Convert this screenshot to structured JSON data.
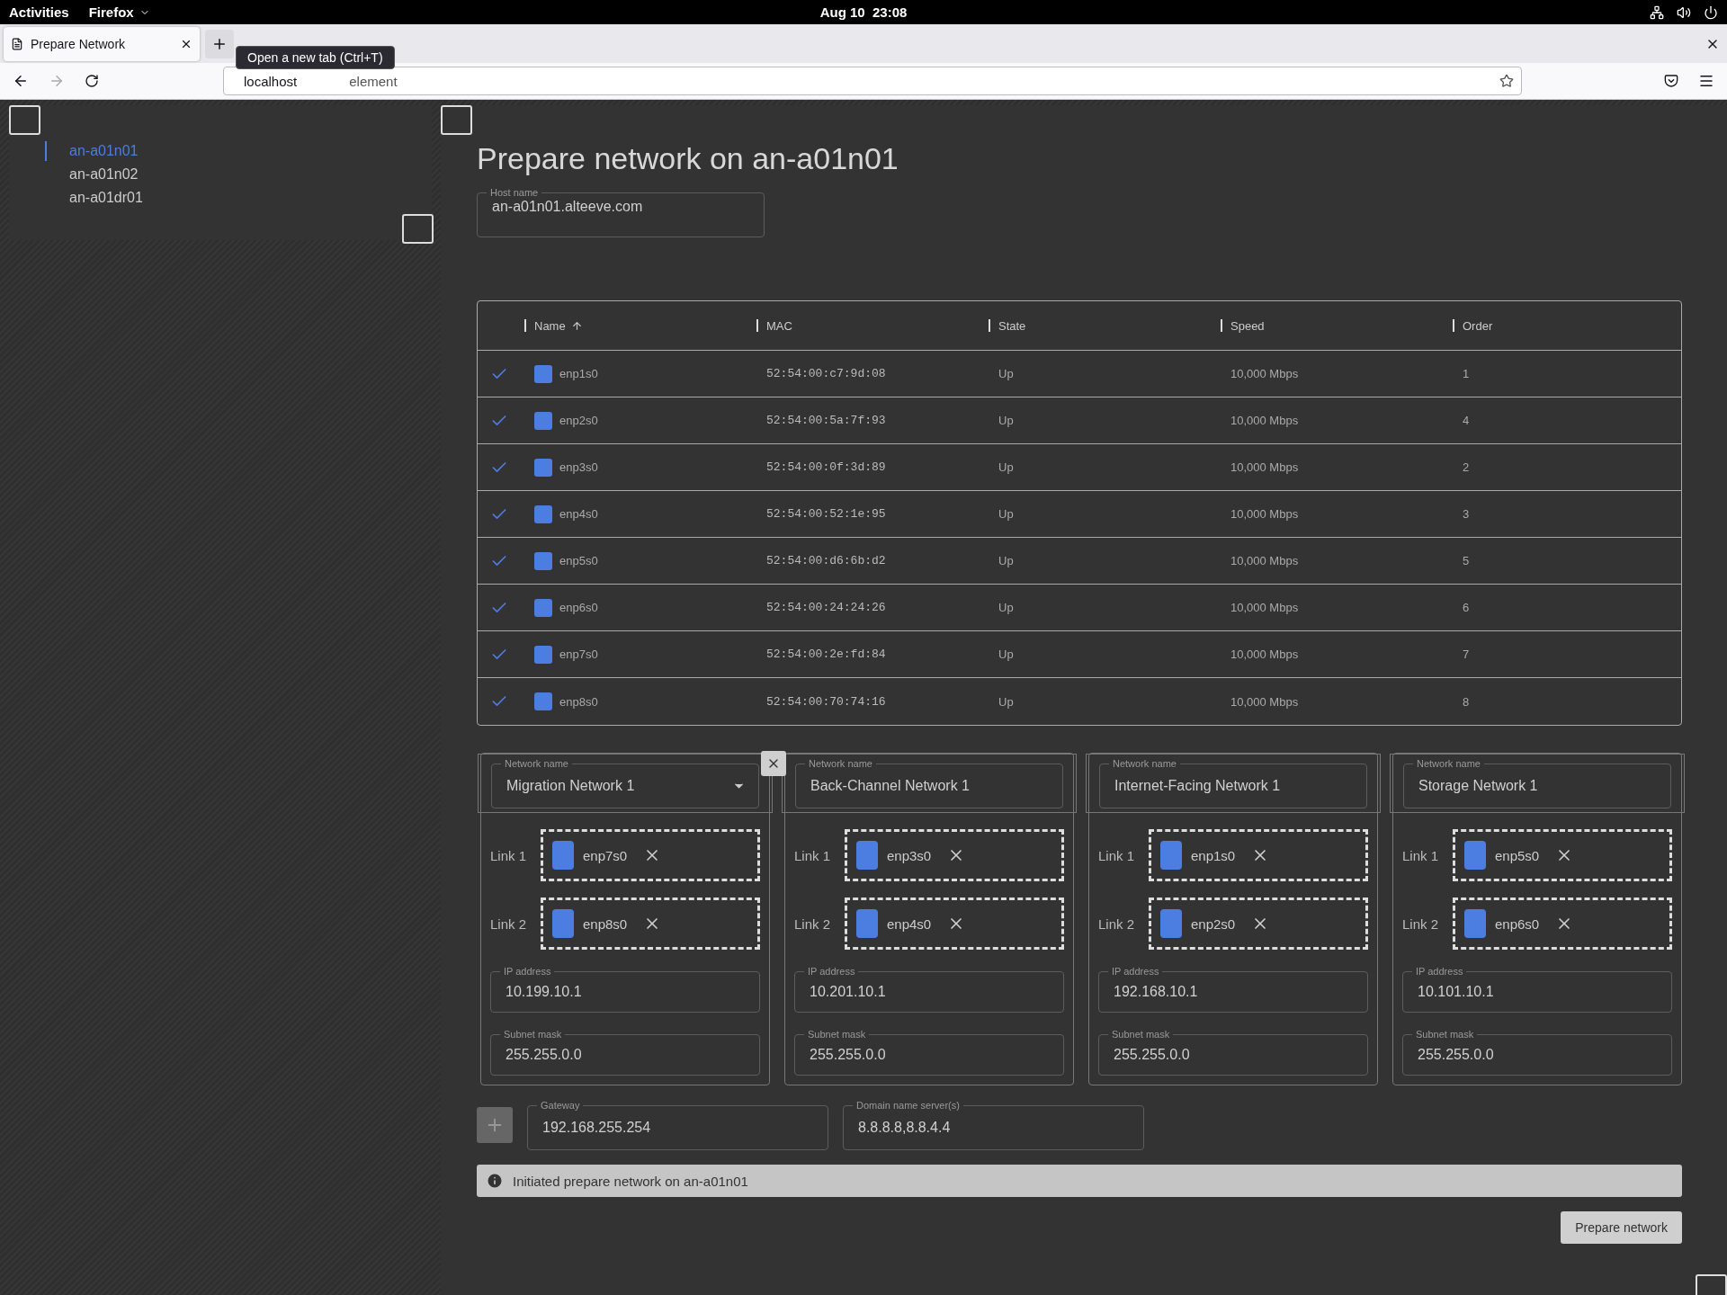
{
  "system_bar": {
    "activities": "Activities",
    "app": "Firefox",
    "clock": "Aug 10  23:08"
  },
  "browser": {
    "tab": {
      "title": "Prepare Network",
      "selected": true
    },
    "tooltip": "Open a new tab (Ctrl+T)",
    "url_host": "localhost",
    "url_tail": "element"
  },
  "sidebar": {
    "items": [
      {
        "label": "an-a01n01",
        "selected": true
      },
      {
        "label": "an-a01n02",
        "selected": false
      },
      {
        "label": "an-a01dr01",
        "selected": false
      }
    ]
  },
  "title": "Prepare network on an-a01n01",
  "host_name": {
    "label": "Host name",
    "value": "an-a01n01.alteeve.com"
  },
  "table": {
    "columns": [
      {
        "label": "Name",
        "sorted": true
      },
      {
        "label": "MAC",
        "sorted": false
      },
      {
        "label": "State",
        "sorted": false
      },
      {
        "label": "Speed",
        "sorted": false
      },
      {
        "label": "Order",
        "sorted": false
      }
    ],
    "rows": [
      {
        "checked": true,
        "name": "enp1s0",
        "mac": "52:54:00:c7:9d:08",
        "state": "Up",
        "speed": "10,000 Mbps",
        "order": "1"
      },
      {
        "checked": true,
        "name": "enp2s0",
        "mac": "52:54:00:5a:7f:93",
        "state": "Up",
        "speed": "10,000 Mbps",
        "order": "4"
      },
      {
        "checked": true,
        "name": "enp3s0",
        "mac": "52:54:00:0f:3d:89",
        "state": "Up",
        "speed": "10,000 Mbps",
        "order": "2"
      },
      {
        "checked": true,
        "name": "enp4s0",
        "mac": "52:54:00:52:1e:95",
        "state": "Up",
        "speed": "10,000 Mbps",
        "order": "3"
      },
      {
        "checked": true,
        "name": "enp5s0",
        "mac": "52:54:00:d6:6b:d2",
        "state": "Up",
        "speed": "10,000 Mbps",
        "order": "5"
      },
      {
        "checked": true,
        "name": "enp6s0",
        "mac": "52:54:00:24:24:26",
        "state": "Up",
        "speed": "10,000 Mbps",
        "order": "6"
      },
      {
        "checked": true,
        "name": "enp7s0",
        "mac": "52:54:00:2e:fd:84",
        "state": "Up",
        "speed": "10,000 Mbps",
        "order": "7"
      },
      {
        "checked": true,
        "name": "enp8s0",
        "mac": "52:54:00:70:74:16",
        "state": "Up",
        "speed": "10,000 Mbps",
        "order": "8"
      }
    ]
  },
  "networks": [
    {
      "name_label": "Network name",
      "name": "Migration Network 1",
      "dropdown": true,
      "removable": true,
      "links": [
        {
          "label": "Link 1",
          "interface": "enp7s0"
        },
        {
          "label": "Link 2",
          "interface": "enp8s0"
        }
      ],
      "ip": {
        "label": "IP address",
        "value": "10.199.10.1"
      },
      "mask": {
        "label": "Subnet mask",
        "value": "255.255.0.0"
      }
    },
    {
      "name_label": "Network name",
      "name": "Back-Channel Network 1",
      "dropdown": false,
      "removable": false,
      "links": [
        {
          "label": "Link 1",
          "interface": "enp3s0"
        },
        {
          "label": "Link 2",
          "interface": "enp4s0"
        }
      ],
      "ip": {
        "label": "IP address",
        "value": "10.201.10.1"
      },
      "mask": {
        "label": "Subnet mask",
        "value": "255.255.0.0"
      }
    },
    {
      "name_label": "Network name",
      "name": "Internet-Facing Network 1",
      "dropdown": false,
      "removable": false,
      "links": [
        {
          "label": "Link 1",
          "interface": "enp1s0"
        },
        {
          "label": "Link 2",
          "interface": "enp2s0"
        }
      ],
      "ip": {
        "label": "IP address",
        "value": "192.168.10.1"
      },
      "mask": {
        "label": "Subnet mask",
        "value": "255.255.0.0"
      }
    },
    {
      "name_label": "Network name",
      "name": "Storage Network 1",
      "dropdown": false,
      "removable": false,
      "links": [
        {
          "label": "Link 1",
          "interface": "enp5s0"
        },
        {
          "label": "Link 2",
          "interface": "enp6s0"
        }
      ],
      "ip": {
        "label": "IP address",
        "value": "10.101.10.1"
      },
      "mask": {
        "label": "Subnet mask",
        "value": "255.255.0.0"
      }
    }
  ],
  "add_button": {
    "disabled": true
  },
  "gateway": {
    "label": "Gateway",
    "value": "192.168.255.254"
  },
  "dns": {
    "label": "Domain name server(s)",
    "value": "8.8.8.8,8.8.4.4"
  },
  "message": "Initiated prepare network on an-a01n01",
  "submit": "Prepare network"
}
